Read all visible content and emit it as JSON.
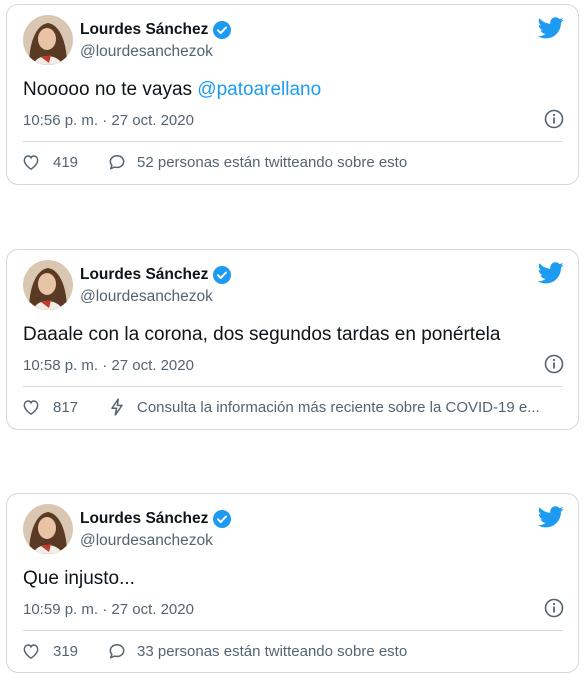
{
  "tweets": [
    {
      "author": "Lourdes Sánchez",
      "handle": "@lourdesanchezok",
      "text": "Nooooo no te vayas ",
      "mention": "@patoarellano",
      "timestamp": "10:56 p. m. · 27 oct. 2020",
      "likes": "419",
      "secondary_icon": "speech-bubble-icon",
      "secondary_text": "52 personas están twitteando sobre esto"
    },
    {
      "author": "Lourdes Sánchez",
      "handle": "@lourdesanchezok",
      "text": "Daaale con la corona, dos segundos tardas en ponértela",
      "mention": "",
      "timestamp": "10:58 p. m. · 27 oct. 2020",
      "likes": "817",
      "secondary_icon": "lightning-icon",
      "secondary_text": "Consulta la información más reciente sobre la COVID-19 e..."
    },
    {
      "author": "Lourdes Sánchez",
      "handle": "@lourdesanchezok",
      "text": "Que injusto...",
      "mention": "",
      "timestamp": "10:59 p. m. · 27 oct. 2020",
      "likes": "319",
      "secondary_icon": "speech-bubble-icon",
      "secondary_text": "33 personas están twitteando sobre esto"
    }
  ],
  "colors": {
    "accent": "#1d9bf0",
    "text": "#0f1419",
    "muted": "#536471",
    "border": "#cfd9de"
  }
}
